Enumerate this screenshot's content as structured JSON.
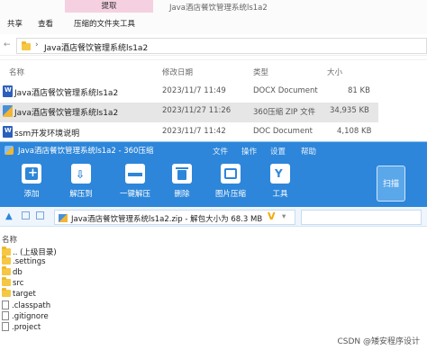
{
  "explorer": {
    "context_tab": "提取",
    "window_title": "Java酒店餐饮管理系统ls1a2",
    "ribbon_tabs": [
      "共享",
      "查看",
      "压缩的文件夹工具"
    ],
    "breadcrumb": "Java酒店餐饮管理系统ls1a2",
    "headers": {
      "name": "名称",
      "modified": "修改日期",
      "type": "类型",
      "size": "大小"
    },
    "files": [
      {
        "name": "Java酒店餐饮管理系统ls1a2",
        "modified": "2023/11/7 11:49",
        "type": "DOCX Document",
        "size": "81 KB",
        "icon": "word-icon"
      },
      {
        "name": "Java酒店餐饮管理系统ls1a2",
        "modified": "2023/11/27 11:26",
        "type": "360压缩 ZIP 文件",
        "size": "34,935 KB",
        "icon": "zip-icon"
      },
      {
        "name": "ssm开发环境说明",
        "modified": "2023/11/7 11:42",
        "type": "DOC Document",
        "size": "4,108 KB",
        "icon": "word-icon"
      }
    ]
  },
  "zip": {
    "title": "Java酒店餐饮管理系统ls1a2 - 360压缩",
    "menu": [
      "文件",
      "操作",
      "设置",
      "帮助"
    ],
    "toolbar": [
      "添加",
      "解压到",
      "一键解压",
      "删除",
      "图片压缩",
      "工具"
    ],
    "scan_label": "扫描",
    "path": "Java酒店餐饮管理系统ls1a2.zip - 解包大小为 68.3 MB",
    "list_header": "名称",
    "entries": [
      {
        "name": ".. (上级目录)",
        "kind": "folder"
      },
      {
        "name": ".settings",
        "kind": "folder"
      },
      {
        "name": "db",
        "kind": "folder"
      },
      {
        "name": "src",
        "kind": "folder"
      },
      {
        "name": "target",
        "kind": "folder"
      },
      {
        "name": ".classpath",
        "kind": "file"
      },
      {
        "name": ".gitignore",
        "kind": "file"
      },
      {
        "name": ".project",
        "kind": "file"
      }
    ]
  },
  "watermark": "CSDN @矮安程序设计",
  "colors": {
    "accent": "#2d86d9",
    "context_tab": "#f5d0e0",
    "folder": "#f6c744"
  }
}
